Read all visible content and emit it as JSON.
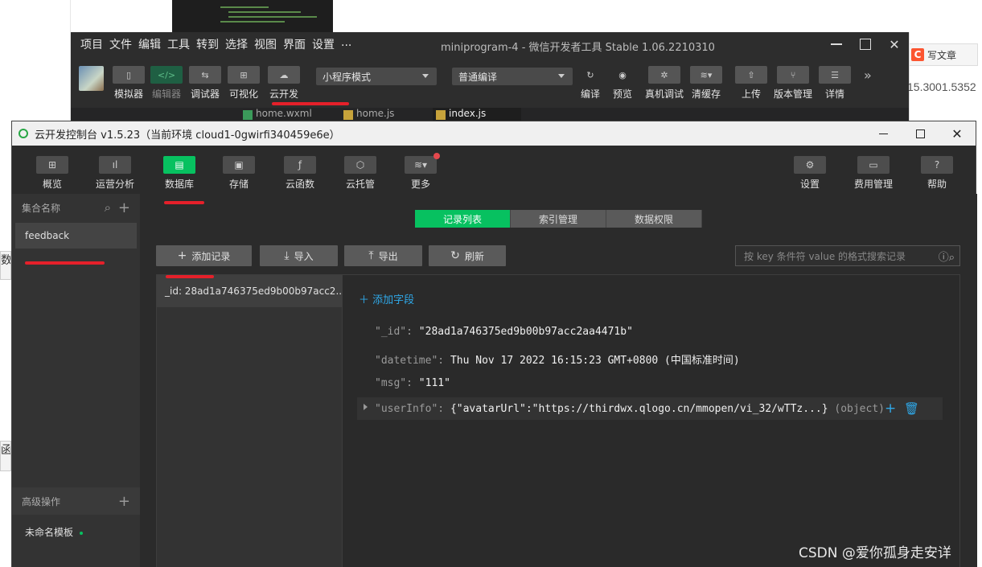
{
  "background": {
    "left_edge_chars": [
      "数",
      "函"
    ],
    "csdn_tab": {
      "logo": "C",
      "label": "写文章"
    },
    "version_fragment": "15.3001.5352"
  },
  "devtools": {
    "menu": [
      "项目",
      "文件",
      "编辑",
      "工具",
      "转到",
      "选择",
      "视图",
      "界面",
      "设置",
      "..."
    ],
    "title": "miniprogram-4 - 微信开发者工具 Stable 1.06.2210310",
    "toolbar_left": [
      {
        "icon": "phone-icon",
        "label": "模拟器"
      },
      {
        "icon": "code-icon",
        "label": "编辑器",
        "active": true
      },
      {
        "icon": "debug-icon",
        "label": "调试器"
      },
      {
        "icon": "layout-icon",
        "label": "可视化"
      },
      {
        "icon": "cloud-icon",
        "label": "云开发"
      }
    ],
    "mode_select": "小程序模式",
    "compile_select": "普通编译",
    "toolbar_right": [
      {
        "icon": "refresh-icon",
        "label": "编译"
      },
      {
        "icon": "eye-icon",
        "label": "预览"
      },
      {
        "icon": "bug-icon",
        "label": "真机调试"
      },
      {
        "icon": "layers-icon",
        "label": "清缓存"
      },
      {
        "icon": "upload-icon",
        "label": "上传"
      },
      {
        "icon": "branch-icon",
        "label": "版本管理"
      },
      {
        "icon": "menu-icon",
        "label": "详情"
      }
    ],
    "file_tabs": [
      "home.wxml",
      "home.js",
      "index.js"
    ]
  },
  "console": {
    "title": "云开发控制台 v1.5.23（当前环境 cloud1-0gwirfi340459e6e）",
    "nav": [
      {
        "icon": "grid-icon",
        "label": "概览"
      },
      {
        "icon": "bar-chart-icon",
        "label": "运营分析"
      },
      {
        "icon": "database-icon",
        "label": "数据库",
        "active": true
      },
      {
        "icon": "storage-icon",
        "label": "存储"
      },
      {
        "icon": "function-icon",
        "label": "云函数"
      },
      {
        "icon": "box-icon",
        "label": "云托管"
      },
      {
        "icon": "layers-icon",
        "label": "更多",
        "badge": true
      }
    ],
    "nav_right": [
      {
        "icon": "gear-icon",
        "label": "设置"
      },
      {
        "icon": "billing-icon",
        "label": "费用管理"
      },
      {
        "icon": "help-icon",
        "label": "帮助"
      }
    ],
    "sidebar": {
      "header": "集合名称",
      "collections": [
        "feedback"
      ],
      "advanced_header": "高级操作",
      "template": "未命名模板"
    },
    "tabs": [
      "记录列表",
      "索引管理",
      "数据权限"
    ],
    "actions": {
      "add_record": "添加记录",
      "import": "导入",
      "export": "导出",
      "refresh": "刷新"
    },
    "search_placeholder": "按 key 条件符 value 的格式搜索记录",
    "records": [
      "_id: 28ad1a746375ed9b00b97acc2..."
    ],
    "detail": {
      "add_field": "添加字段",
      "fields": [
        {
          "key": "\"_id\"",
          "sep": ": ",
          "value": "\"28ad1a746375ed9b00b97acc2aa4471b\"",
          "type": ""
        },
        {
          "key": "\"datetime\"",
          "sep": ": ",
          "value": "Thu Nov 17 2022 16:15:23 GMT+0800 (中国标准时间)",
          "type": ""
        },
        {
          "key": "\"msg\"",
          "sep": ": ",
          "value": "\"111\"",
          "type": ""
        },
        {
          "key": "\"userInfo\"",
          "sep": ": ",
          "value": "{\"avatarUrl\":\"https://thirdwx.qlogo.cn/mmopen/vi_32/wTTz...}",
          "type": "(object)"
        }
      ]
    }
  },
  "watermark": "CSDN @爱你孤身走安详",
  "colors": {
    "accent": "#07c160",
    "link": "#2fa8e8",
    "annotation": "#e5202a"
  }
}
